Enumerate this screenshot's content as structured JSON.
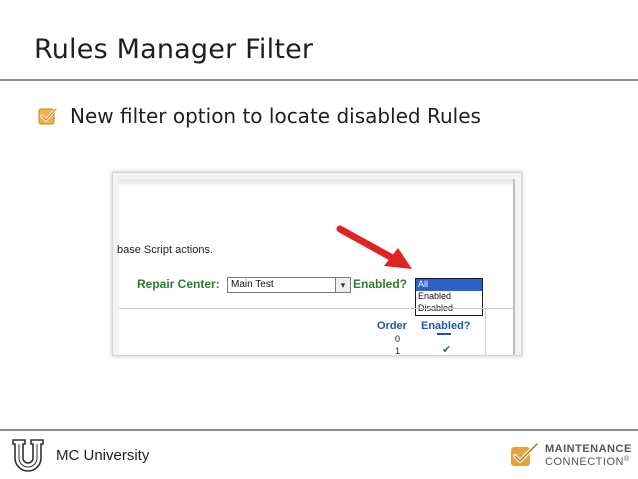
{
  "slide": {
    "title": "Rules Manager Filter",
    "bullet": "New filter option to locate disabled Rules"
  },
  "screenshot": {
    "script_text": "base Script actions.",
    "repair_center_label": "Repair Center:",
    "repair_center_value": "Main Test",
    "enabled_label": "Enabled?",
    "enabled_options": [
      "All",
      "Enabled",
      "Disabled"
    ],
    "enabled_selected": "All",
    "columns": {
      "order": "Order",
      "enabled": "Enabled?"
    },
    "row1_order": "0",
    "row2_order": "1",
    "arrow_color": "#e02424"
  },
  "footer": {
    "org": "MC University",
    "brand_line1": "MAINTENANCE",
    "brand_line2": "CONNECTION",
    "brand_mark": "®"
  },
  "colors": {
    "accent_orange": "#e8a23a",
    "label_green": "#2f7a2f",
    "header_blue": "#2255aa",
    "selection_blue": "#2d62c8"
  },
  "icons": {
    "bullet": "checkbox-checked-icon",
    "dropdown": "chevron-down-icon",
    "footer_left": "university-u-logo",
    "footer_right": "maintenance-connection-logo"
  }
}
